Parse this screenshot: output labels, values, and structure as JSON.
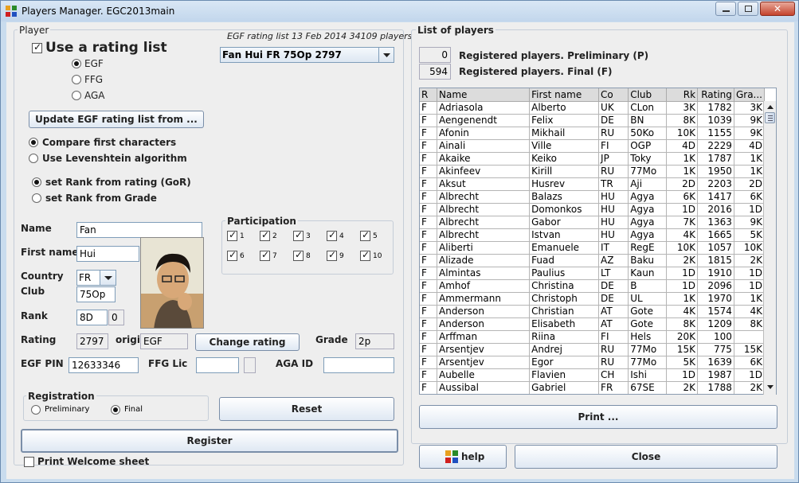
{
  "window": {
    "title": "Players Manager. EGC2013main",
    "close": "✕"
  },
  "player": {
    "group_label": "Player",
    "rating_list_info": "EGF rating list 13 Feb 2014 34109 players",
    "use_rating_list": "Use a rating list",
    "selected_player": "Fan Hui FR 75Op 2797",
    "rating_sources": [
      "EGF",
      "FFG",
      "AGA"
    ],
    "update_button": "Update EGF rating list from ...",
    "compare_first": "Compare first characters",
    "levenshtein": "Use Levenshtein algorithm",
    "rank_from_rating": "set Rank from rating (GoR)",
    "rank_from_grade": "set Rank from Grade",
    "name_label": "Name",
    "name_value": "Fan",
    "firstname_label": "First name",
    "firstname_value": "Hui",
    "country_label": "Country",
    "country_value": "FR",
    "club_label": "Club",
    "club_value": "75Op",
    "rank_label": "Rank",
    "rank_value": "8D",
    "rank_extra": "0",
    "rating_label": "Rating",
    "rating_value": "2797",
    "origin_label": "origin",
    "origin_value": "EGF",
    "change_rating": "Change rating",
    "grade_label": "Grade",
    "grade_value": "2p",
    "egfpin_label": "EGF PIN",
    "egfpin_value": "12633346",
    "ffglic_label": "FFG Lic",
    "ffglic_value": "",
    "agaid_label": "AGA ID",
    "agaid_value": "",
    "participation_label": "Participation",
    "rounds": [
      "1",
      "2",
      "3",
      "4",
      "5",
      "6",
      "7",
      "8",
      "9",
      "10"
    ],
    "registration_label": "Registration",
    "preliminary": "Preliminary",
    "final": "Final",
    "reset": "Reset",
    "register": "Register",
    "print_welcome": "Print Welcome sheet"
  },
  "list": {
    "group_label": "List of players",
    "prelim_count": "0",
    "prelim_text": "Registered players. Preliminary (P)",
    "final_count": "594",
    "final_text": "Registered players. Final (F)",
    "columns": [
      "R",
      "Name",
      "First name",
      "Co",
      "Club",
      "Rk",
      "Rating",
      "Gra..."
    ],
    "rows": [
      [
        "F",
        "Adriasola",
        "Alberto",
        "UK",
        "CLon",
        "3K",
        "1782",
        "3K"
      ],
      [
        "F",
        "Aengenendt",
        "Felix",
        "DE",
        "BN",
        "8K",
        "1039",
        "9K"
      ],
      [
        "F",
        "Afonin",
        "Mikhail",
        "RU",
        "50Ko",
        "10K",
        "1155",
        "9K"
      ],
      [
        "F",
        "Ainali",
        "Ville",
        "FI",
        "OGP",
        "4D",
        "2229",
        "4D"
      ],
      [
        "F",
        "Akaike",
        "Keiko",
        "JP",
        "Toky",
        "1K",
        "1787",
        "1K"
      ],
      [
        "F",
        "Akinfeev",
        "Kirill",
        "RU",
        "77Mo",
        "1K",
        "1950",
        "1K"
      ],
      [
        "F",
        "Aksut",
        "Husrev",
        "TR",
        "Aji",
        "2D",
        "2203",
        "2D"
      ],
      [
        "F",
        "Albrecht",
        "Balazs",
        "HU",
        "Agya",
        "6K",
        "1417",
        "6K"
      ],
      [
        "F",
        "Albrecht",
        "Domonkos",
        "HU",
        "Agya",
        "1D",
        "2016",
        "1D"
      ],
      [
        "F",
        "Albrecht",
        "Gabor",
        "HU",
        "Agya",
        "7K",
        "1363",
        "9K"
      ],
      [
        "F",
        "Albrecht",
        "Istvan",
        "HU",
        "Agya",
        "4K",
        "1665",
        "5K"
      ],
      [
        "F",
        "Aliberti",
        "Emanuele",
        "IT",
        "RegE",
        "10K",
        "1057",
        "10K"
      ],
      [
        "F",
        "Alizade",
        "Fuad",
        "AZ",
        "Baku",
        "2K",
        "1815",
        "2K"
      ],
      [
        "F",
        "Almintas",
        "Paulius",
        "LT",
        "Kaun",
        "1D",
        "1910",
        "1D"
      ],
      [
        "F",
        "Amhof",
        "Christina",
        "DE",
        "B",
        "1D",
        "2096",
        "1D"
      ],
      [
        "F",
        "Ammermann",
        "Christoph",
        "DE",
        "UL",
        "1K",
        "1970",
        "1K"
      ],
      [
        "F",
        "Anderson",
        "Christian",
        "AT",
        "Gote",
        "4K",
        "1574",
        "4K"
      ],
      [
        "F",
        "Anderson",
        "Elisabeth",
        "AT",
        "Gote",
        "8K",
        "1209",
        "8K"
      ],
      [
        "F",
        "Arffman",
        "Riina",
        "FI",
        "Hels",
        "20K",
        "100",
        ""
      ],
      [
        "F",
        "Arsentjev",
        "Andrej",
        "RU",
        "77Mo",
        "15K",
        "775",
        "15K"
      ],
      [
        "F",
        "Arsentjev",
        "Egor",
        "RU",
        "77Mo",
        "5K",
        "1639",
        "6K"
      ],
      [
        "F",
        "Aubelle",
        "Flavien",
        "CH",
        "Ishi",
        "1D",
        "1987",
        "1D"
      ],
      [
        "F",
        "Aussibal",
        "Gabriel",
        "FR",
        "67SE",
        "2K",
        "1788",
        "2K"
      ]
    ],
    "print": "Print ...",
    "help": "help",
    "close": "Close"
  }
}
